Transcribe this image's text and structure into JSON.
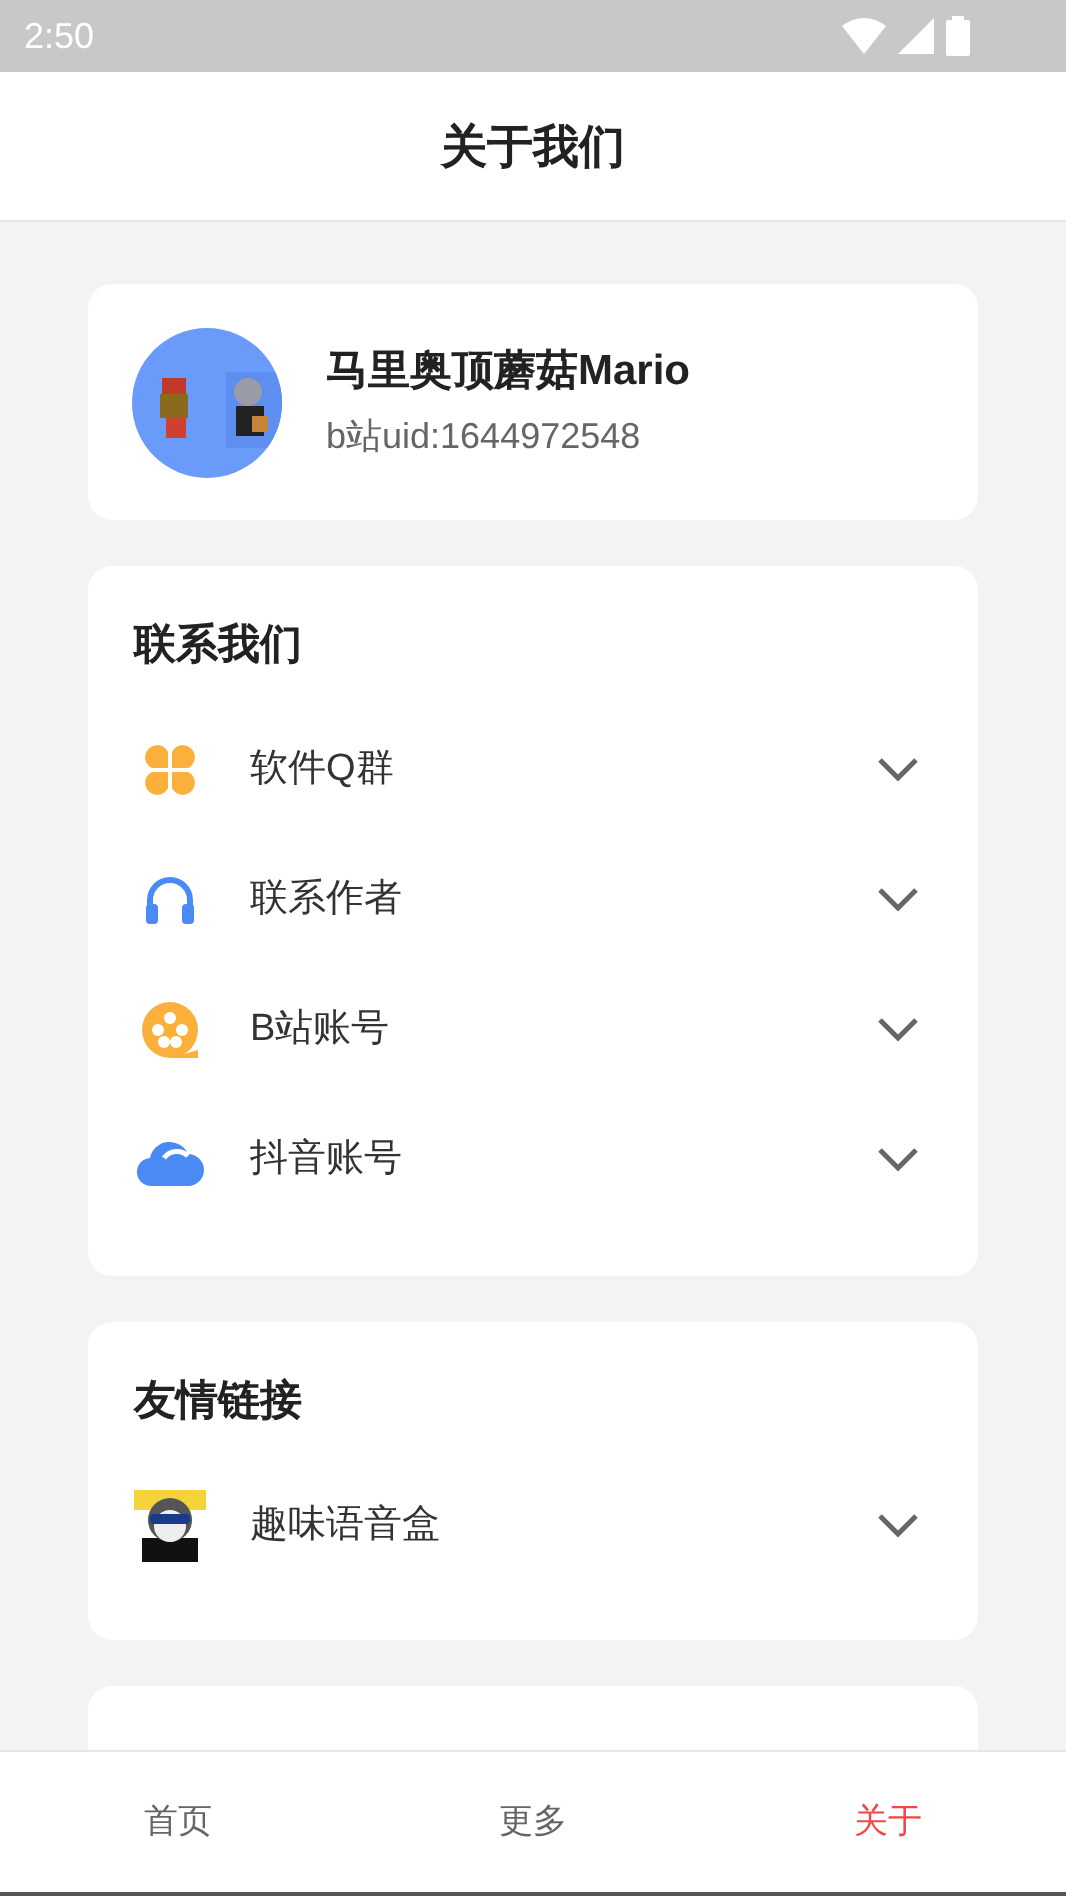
{
  "status_bar": {
    "time": "2:50"
  },
  "header": {
    "title": "关于我们"
  },
  "profile": {
    "name": "马里奥顶蘑菇Mario",
    "uid": "b站uid:1644972548"
  },
  "contact": {
    "title": "联系我们",
    "items": [
      {
        "label": "软件Q群",
        "expanded": false
      },
      {
        "label": "联系作者",
        "expanded": false
      },
      {
        "label": "B站账号",
        "expanded": false
      },
      {
        "label": "抖音账号",
        "expanded": false
      }
    ]
  },
  "links": {
    "title": "友情链接",
    "items": [
      {
        "label": "趣味语音盒",
        "expanded": false
      }
    ]
  },
  "bottom_nav": [
    {
      "label": "首页",
      "selected": false
    },
    {
      "label": "更多",
      "selected": false
    },
    {
      "label": "关于",
      "selected": true
    }
  ]
}
